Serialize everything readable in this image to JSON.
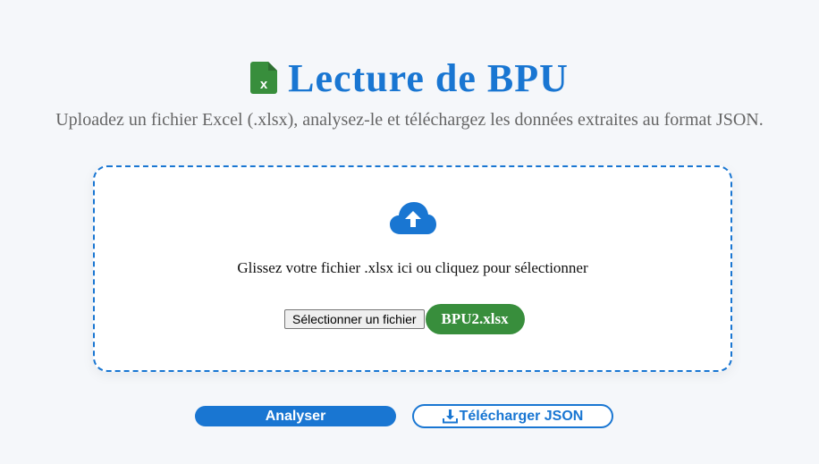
{
  "header": {
    "title": "Lecture de BPU",
    "icon": "file-excel-icon",
    "subtitle": "Uploadez un fichier Excel (.xlsx), analysez-le et téléchargez les données extraites au format JSON."
  },
  "dropzone": {
    "icon": "cloud-upload-icon",
    "instruction": "Glissez votre fichier .xlsx ici ou cliquez pour sélectionner",
    "file_button_label": "Sélectionner un fichier",
    "selected_file": "BPU2.xlsx"
  },
  "actions": {
    "analyse_label": "Analyser",
    "download_label": "Télécharger JSON",
    "download_icon": "download-icon"
  },
  "colors": {
    "accent": "#1976d2",
    "success": "#388e3c",
    "excel": "#388e3c",
    "background": "#f5f7fa"
  }
}
